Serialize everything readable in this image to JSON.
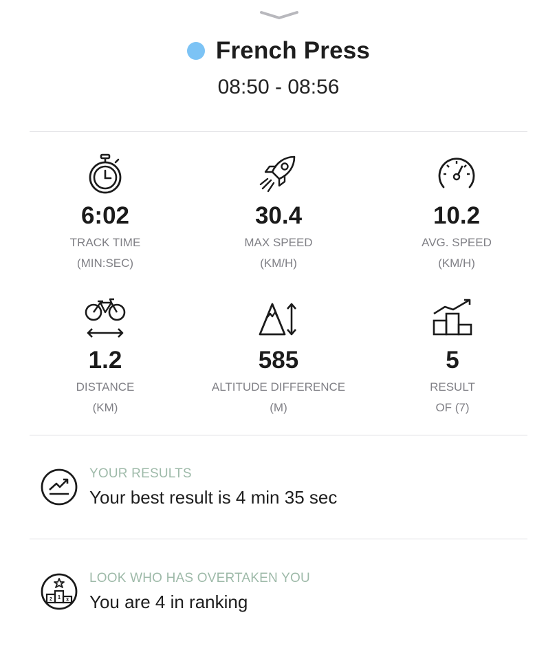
{
  "header": {
    "title": "French Press",
    "time_range": "08:50 - 08:56",
    "dot_color": "#7cc3f5"
  },
  "stats": [
    {
      "icon": "stopwatch-icon",
      "value": "6:02",
      "label": "TRACK TIME",
      "unit": "(MIN:SEC)"
    },
    {
      "icon": "rocket-icon",
      "value": "30.4",
      "label": "MAX SPEED",
      "unit": "(KM/H)"
    },
    {
      "icon": "speedometer-icon",
      "value": "10.2",
      "label": "AVG. SPEED",
      "unit": "(KM/H)"
    },
    {
      "icon": "bicycle-distance-icon",
      "value": "1.2",
      "label": "DISTANCE",
      "unit": "(KM)"
    },
    {
      "icon": "mountain-altitude-icon",
      "value": "585",
      "label": "ALTITUDE DIFFERENCE",
      "unit": "(M)"
    },
    {
      "icon": "podium-trend-icon",
      "value": "5",
      "label": "RESULT",
      "unit": "OF (7)"
    }
  ],
  "results": {
    "heading": "YOUR RESULTS",
    "text": "Your best result is 4 min 35 sec",
    "icon": "trend-up-circle-icon"
  },
  "overtaken": {
    "heading": "LOOK WHO HAS OVERTAKEN YOU",
    "text": "You are 4 in ranking",
    "icon": "podium-circle-icon"
  },
  "colors": {
    "accent_heading": "#9ebaa9",
    "label_gray": "#808086",
    "divider": "#dedee2"
  }
}
